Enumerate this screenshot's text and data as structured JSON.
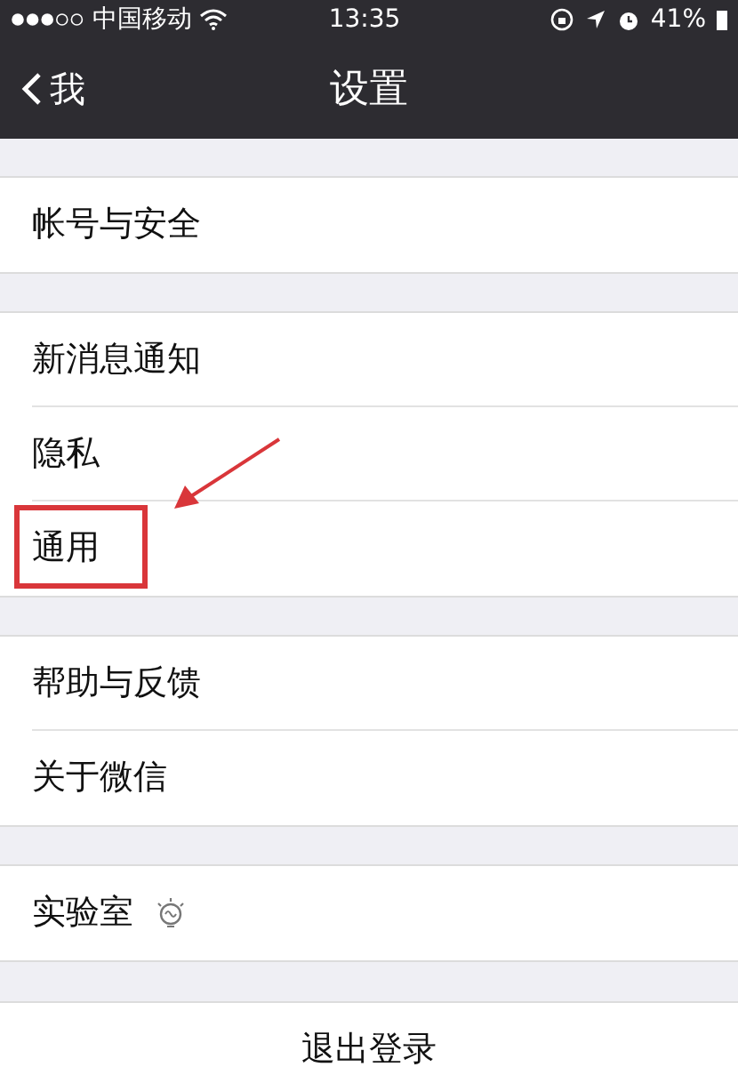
{
  "status_bar": {
    "carrier": "中国移动",
    "time": "13:35",
    "battery": "41%"
  },
  "nav": {
    "back": "我",
    "title": "设置"
  },
  "groups": [
    [
      {
        "label": "帐号与安全",
        "kind": "plain",
        "highlighted": false
      }
    ],
    [
      {
        "label": "新消息通知",
        "kind": "plain",
        "highlighted": false
      },
      {
        "label": "隐私",
        "kind": "plain",
        "highlighted": false
      },
      {
        "label": "通用",
        "kind": "plain",
        "highlighted": true
      }
    ],
    [
      {
        "label": "帮助与反馈",
        "kind": "plain",
        "highlighted": false
      },
      {
        "label": "关于微信",
        "kind": "plain",
        "highlighted": false
      }
    ],
    [
      {
        "label": "实验室",
        "kind": "lab",
        "highlighted": false
      }
    ]
  ],
  "logout": "退出登录"
}
